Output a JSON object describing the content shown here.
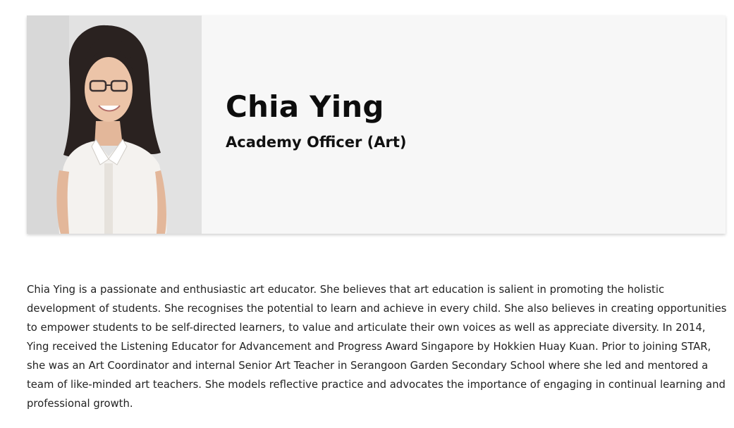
{
  "profile": {
    "name": "Chia Ying",
    "role": "Academy Officer (Art)",
    "bio": "Chia Ying is a passionate and enthusiastic art educator.  She believes that art education is salient in promoting the holistic development of students.  She recognises the potential to learn and achieve in every child.  She also believes in creating opportunities to empower students to be self-directed learners, to value and articulate their own voices as well as appreciate diversity.  In 2014, Ying received the Listening Educator for Advancement and Progress Award Singapore  by Hokkien Huay Kuan. Prior to joining STAR, she was an Art Coordinator and internal Senior Art Teacher in Serangoon Garden Secondary School where she led and mentored a team of like-minded art teachers.  She models reflective practice and advocates the importance of engaging in continual learning and professional growth."
  },
  "colors": {
    "card_background": "#f7f7f7",
    "text": "#1a1a1a"
  }
}
